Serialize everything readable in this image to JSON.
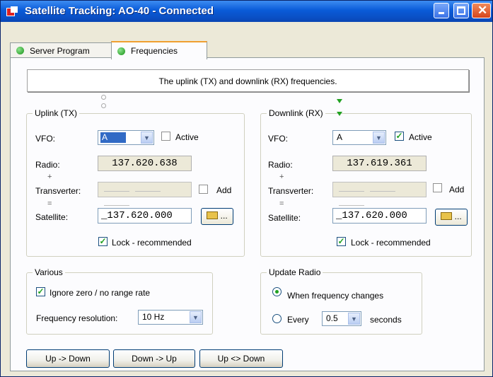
{
  "window": {
    "title": "Satellite Tracking: AO-40 - Connected"
  },
  "tabs": [
    {
      "label": "Server Program",
      "status_color": "#21a121"
    },
    {
      "label": "Frequencies",
      "status_color": "#21a121"
    }
  ],
  "hint": "The uplink (TX) and downlink (RX) frequencies.",
  "uplink": {
    "group_label": "Uplink (TX)",
    "vfo_label": "VFO:",
    "vfo_value": "A",
    "active_label": "Active",
    "active_checked": false,
    "radio_label": "Radio:",
    "radio_value": "137.620.638",
    "plus": "+",
    "transverter_label": "Transverter:",
    "add_label": "Add",
    "add_checked": false,
    "equals": "=",
    "satellite_label": "Satellite:",
    "satellite_value": "_137.620.000",
    "browse_label": "...",
    "lock_label": "Lock - recommended",
    "lock_checked": true
  },
  "downlink": {
    "group_label": "Downlink (RX)",
    "vfo_label": "VFO:",
    "vfo_value": "A",
    "active_label": "Active",
    "active_checked": true,
    "radio_label": "Radio:",
    "radio_value": "137.619.361",
    "plus": "+",
    "transverter_label": "Transverter:",
    "add_label": "Add",
    "add_checked": false,
    "equals": "=",
    "satellite_label": "Satellite:",
    "satellite_value": "_137.620.000",
    "browse_label": "...",
    "lock_label": "Lock - recommended",
    "lock_checked": true
  },
  "various": {
    "group_label": "Various",
    "ignore_label": "Ignore zero / no range rate",
    "ignore_checked": true,
    "resolution_label": "Frequency resolution:",
    "resolution_value": "10 Hz"
  },
  "update_radio": {
    "group_label": "Update Radio",
    "option_changes": "When frequency changes",
    "option_every": "Every",
    "every_value": "0.5",
    "seconds_label": "seconds",
    "selected": "When frequency changes"
  },
  "buttons": {
    "up_down": "Up -> Down",
    "down_up": "Down -> Up",
    "up_swap_down": "Up <> Down"
  },
  "check_glyph": "✓",
  "arrow_glyph": "▼",
  "close_glyph": "✕"
}
